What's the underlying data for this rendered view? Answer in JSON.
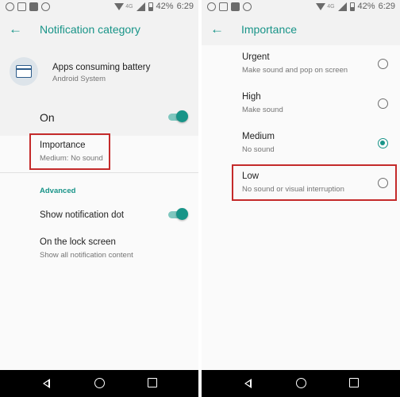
{
  "status_bar": {
    "network": "4G",
    "battery": "42%",
    "time": "6:29"
  },
  "left_screen": {
    "appbar": {
      "title": "Notification category",
      "back_icon": "arrow-left-icon"
    },
    "app": {
      "name": "Apps consuming battery",
      "subtitle": "Android System",
      "icon": "app-window-icon"
    },
    "master_toggle": {
      "label": "On",
      "state": true
    },
    "importance": {
      "title": "Importance",
      "summary": "Medium: No sound"
    },
    "section_header": "Advanced",
    "notification_dot": {
      "label": "Show notification dot",
      "state": true
    },
    "lock_screen": {
      "title": "On the lock screen",
      "summary": "Show all notification content"
    }
  },
  "right_screen": {
    "appbar": {
      "title": "Importance",
      "back_icon": "arrow-left-icon"
    },
    "options": [
      {
        "title": "Urgent",
        "summary": "Make sound and pop on screen",
        "selected": false
      },
      {
        "title": "High",
        "summary": "Make sound",
        "selected": false
      },
      {
        "title": "Medium",
        "summary": "No sound",
        "selected": true
      },
      {
        "title": "Low",
        "summary": "No sound or visual interruption",
        "selected": false
      }
    ]
  },
  "nav_bar": {
    "back": "nav-back-icon",
    "home": "nav-home-icon",
    "recents": "nav-recents-icon"
  },
  "colors": {
    "accent": "#189488",
    "highlight": "#c42a2a",
    "navbar": "#000000"
  }
}
